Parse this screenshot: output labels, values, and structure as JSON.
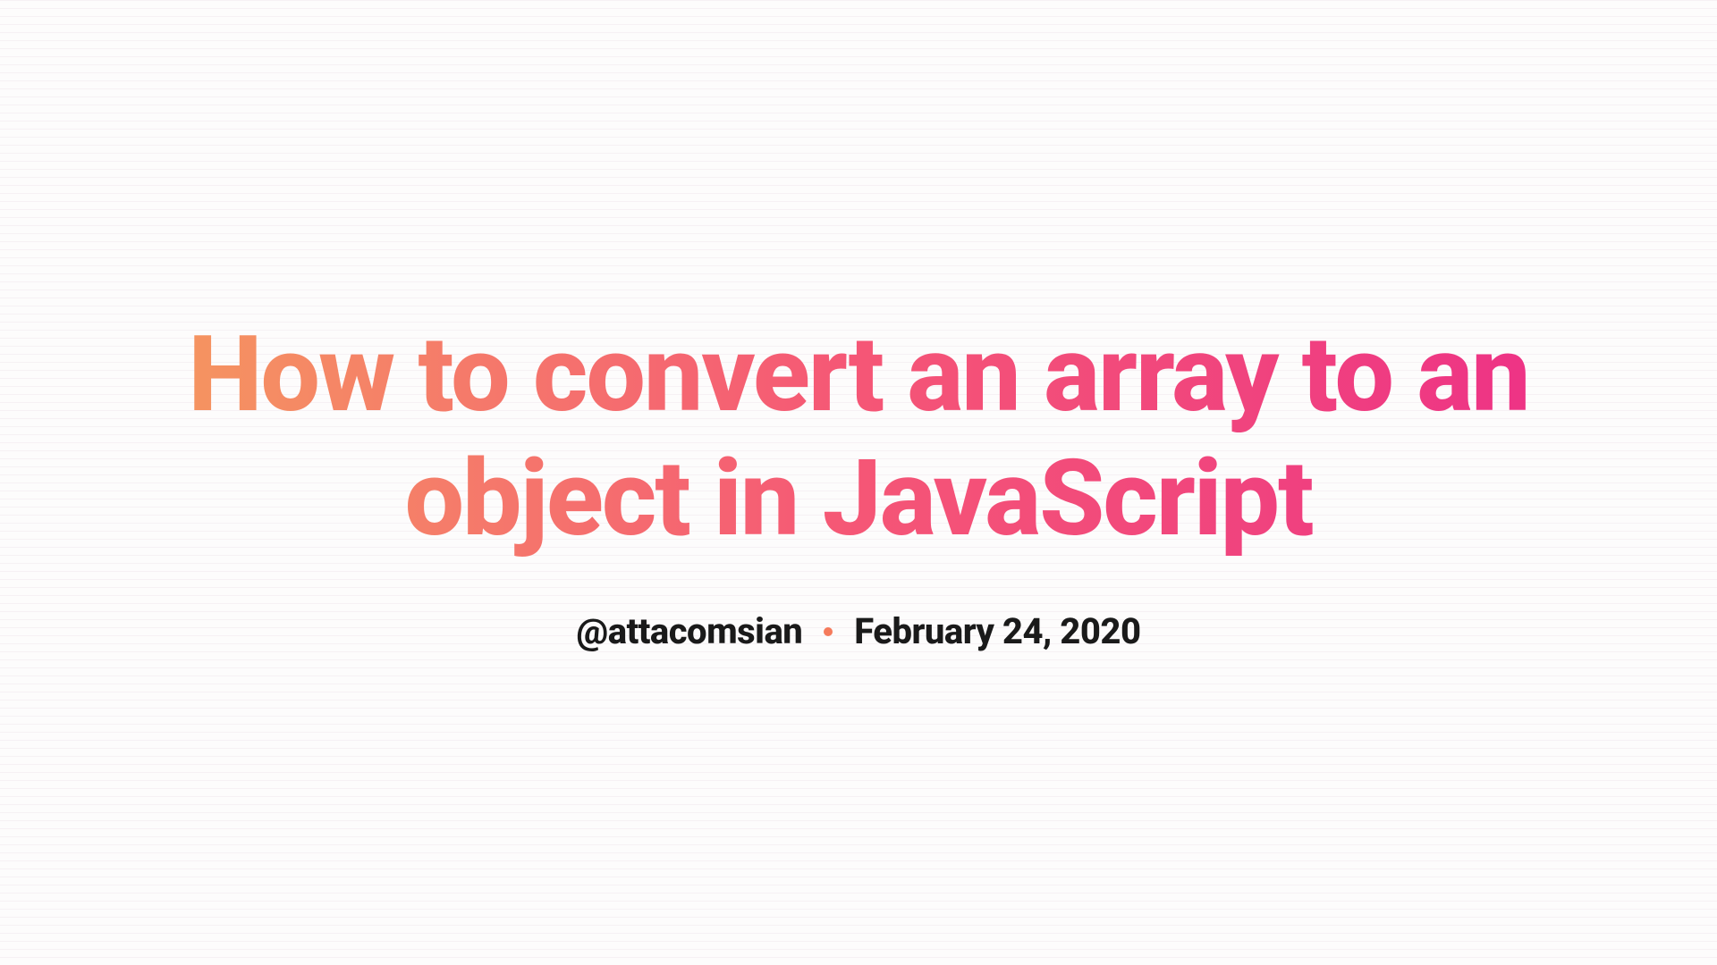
{
  "article": {
    "title": "How to convert an array to an object in JavaScript",
    "author": "@attacomsian",
    "date": "February 24, 2020"
  }
}
